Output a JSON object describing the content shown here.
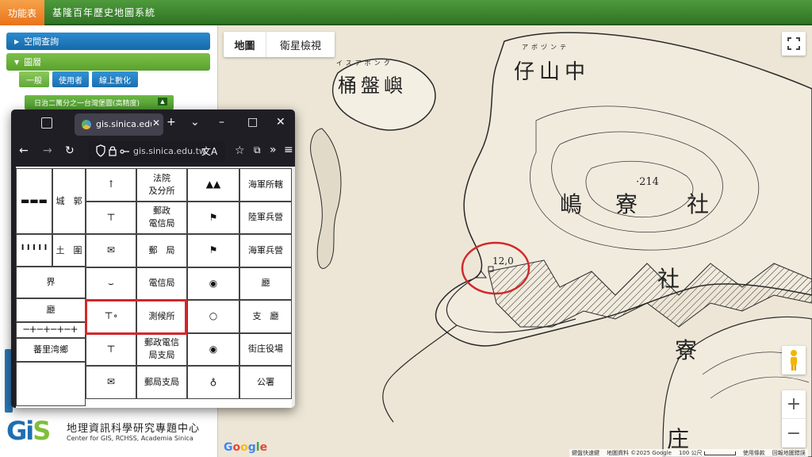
{
  "topbar": {
    "menu_tab": "功能表",
    "title": "基隆百年歷史地圖系統"
  },
  "sidebar": {
    "spatial_query": "空間查詢",
    "layers": "圖層",
    "subtabs": [
      "一般",
      "使用者",
      "線上數化"
    ],
    "map_layer_button": "日治二萬分之一台灣堡圖(高精度)"
  },
  "footer": {
    "logo_prefix": "G",
    "logo_i": "i",
    "logo_suffix": "S",
    "org_name_cn": "地理資訊科學研究專題中心",
    "org_name_en": "Center for GIS, RCHSS, Academia Sinica"
  },
  "map": {
    "type_buttons": [
      "地圖",
      "衛星檢視"
    ],
    "google": "Google",
    "attribution": [
      "鍵盤快速鍵",
      "地圖資料 ©2025 Google",
      "100 公尺",
      "使用條款",
      "回報地圖錯誤"
    ],
    "labels": {
      "zaishanzhong": "仔山中",
      "zaishanzhong_kana": "アボヅンテ",
      "tongpanyu": "桶盤嶼",
      "tongpanyu_kana": "イスアボンク",
      "she": "社",
      "liao": "寮",
      "dao": "嶋",
      "elevation_214": "·214",
      "elevation_12": "12,0",
      "liao2": "寮",
      "zhuang": "庄",
      "she2": "社"
    },
    "colors": {
      "paper": "#ede6d6",
      "ink": "#2a2a2a",
      "highlight": "#d2282a"
    }
  },
  "browser": {
    "tab_title": "gis.sinica.edu.tw",
    "url": "gis.sinica.edu.tw",
    "controls": {
      "new_tab": "+",
      "tab_list": "⌄",
      "minimize": "–",
      "maximize": "□",
      "close": "✕"
    },
    "nav": {
      "back": "←",
      "forward": "→",
      "reload": "↻"
    }
  },
  "legend": {
    "col_b_labels": [
      "法院\n及分所",
      "郵政\n電信局",
      "郵　局",
      "電信局",
      "測候所",
      "郵政電信\n局支局",
      "郵局支局"
    ],
    "col_b_symbols": [
      "↑",
      "⊤",
      "✉",
      "⌣",
      "⊤∘",
      "⊤",
      "✉"
    ],
    "col_c_labels": [
      "海軍所轄",
      "陸軍兵營",
      "海軍兵營",
      "廳",
      "支　廳",
      "街庄役場",
      "公署"
    ],
    "col_c_symbols": [
      "▲▲",
      "⚑",
      "⚑",
      "◉",
      "○",
      "◉",
      "♁"
    ],
    "col_a_labels": [
      "城　郭",
      "土　圍",
      "界",
      "廳",
      "蕃里湾鄉"
    ],
    "col_a_symbols": [
      "▬▬▬",
      "╹╹╹╹╹",
      "",
      "",
      "─+─+─+─+"
    ]
  }
}
